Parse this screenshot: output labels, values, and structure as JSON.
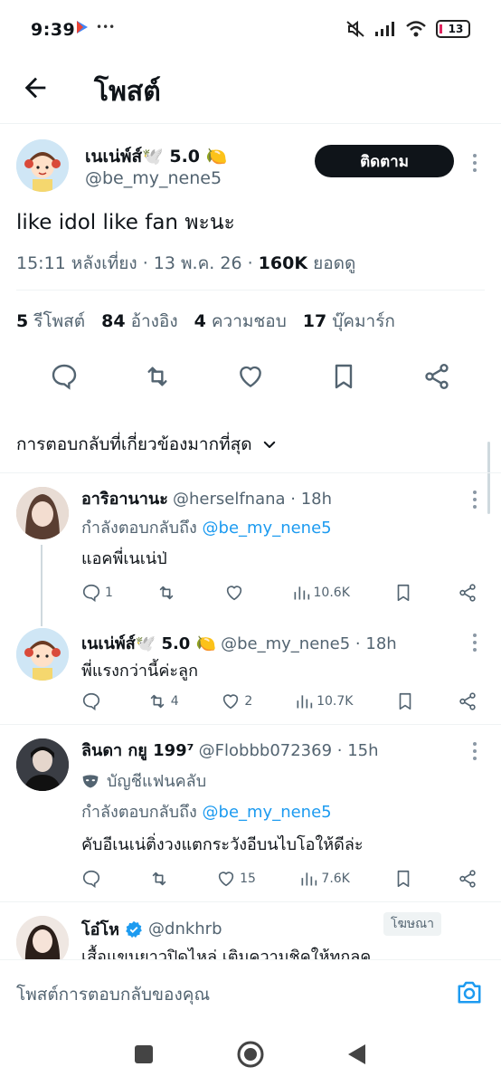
{
  "status_bar": {
    "time": "9:39",
    "extra": "•••",
    "battery": "13"
  },
  "header": {
    "title": "โพสต์"
  },
  "post": {
    "author_name": "เนเน่พ์ส์🕊️ 5.0 🍋",
    "author_handle": "@be_my_nene5",
    "follow_label": "ติดตาม",
    "text": "like idol like fan พะนะ",
    "time": "15:11 หลังเที่ยง · 13 พ.ค. 26 · ",
    "views": "160K",
    "views_label": " ยอดดู"
  },
  "stats": {
    "reposts_count": "5",
    "reposts_label": "รีโพสต์",
    "quotes_count": "84",
    "quotes_label": "อ้างอิง",
    "likes_count": "4",
    "likes_label": "ความชอบ",
    "bookmarks_count": "17",
    "bookmarks_label": "บุ๊คมาร์ก"
  },
  "filter": {
    "label": "การตอบกลับที่เกี่ยวข้องมากที่สุด"
  },
  "replies": [
    {
      "name": "อาริอานานะ",
      "handle": "@herselfnana · 18h",
      "replying_prefix": "กำลังตอบกลับถึง ",
      "replying_to": "@be_my_nene5",
      "text": "แอคพี่เนเน่ป่",
      "replies": "1",
      "reposts": "",
      "likes": "",
      "views": "10.6K"
    },
    {
      "name": "เนเน่พ์ส์🕊️ 5.0 🍋",
      "handle": "@be_my_nene5 · 18h",
      "text": "พี่แรงกว่านี้ค่ะลูก",
      "replies": "",
      "reposts": "4",
      "likes": "2",
      "views": "10.7K"
    },
    {
      "name": "ลินดา กยู 199⁷",
      "handle": "@Flobbb072369 · 15h",
      "fan_account": "บัญชีแฟนคลับ",
      "replying_prefix": "กำลังตอบกลับถึง ",
      "replying_to": "@be_my_nene5",
      "text": "คับอีเนเน่ติ่งวงแตกระวังอีบนไบโอให้ดีล่ะ",
      "replies": "",
      "reposts": "",
      "likes": "15",
      "views": "7.6K"
    },
    {
      "name": "โอ๋โห",
      "handle": "@dnkhrb",
      "ad_label": "โฆษณา",
      "text": "เสื้อแขนยาวปิดไหล่ เติมความชิคให้ทุกลุค"
    }
  ],
  "reply_input": {
    "placeholder": "โพสต์การตอบกลับของคุณ"
  },
  "colors": {
    "accent": "#1d9bf0",
    "text": "#0f1419",
    "muted": "#536471"
  }
}
